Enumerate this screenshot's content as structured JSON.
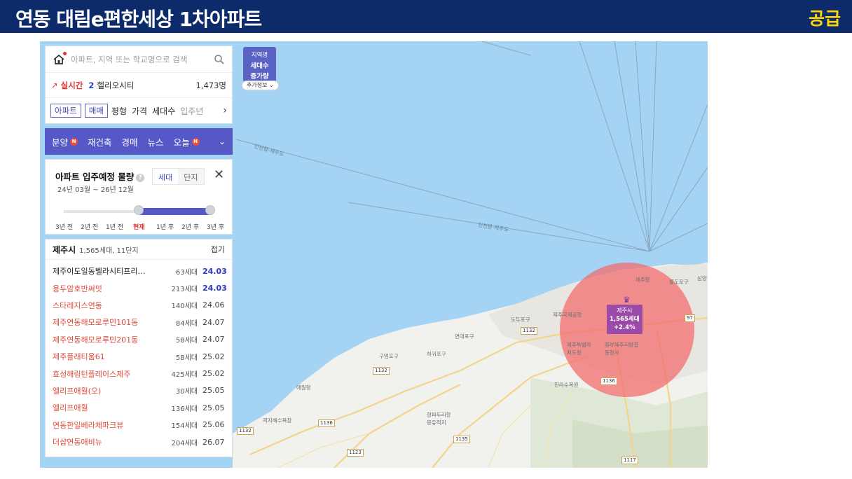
{
  "header": {
    "title": "연동 대림e편한세상 1차아파트",
    "badge": "공급"
  },
  "search": {
    "placeholder": "아파트, 지역 또는 학교명으로 검색"
  },
  "realtime": {
    "label": "실시간",
    "rank": "2",
    "name": "헬리오시티",
    "count": "1,473명"
  },
  "filters": {
    "chips": [
      "아파트",
      "매매"
    ],
    "items": [
      "평형",
      "가격",
      "세대수",
      "입주년"
    ]
  },
  "nav": {
    "items": [
      {
        "label": "분양",
        "new": "N"
      },
      {
        "label": "재건축",
        "new": ""
      },
      {
        "label": "경매",
        "new": ""
      },
      {
        "label": "뉴스",
        "new": ""
      },
      {
        "label": "오늘",
        "new": "N"
      }
    ]
  },
  "volume": {
    "title": "아파트 입주예정 물량",
    "help": "?",
    "range": "24년 03월 ~ 26년 12월",
    "toggle": [
      "세대",
      "단지"
    ],
    "active_toggle": "세대",
    "close": "✕",
    "ticks": [
      "3년 전",
      "2년 전",
      "1년 전",
      "현재",
      "1년 후",
      "2년 후",
      "3년 후"
    ],
    "current": "현재"
  },
  "list": {
    "city": "제주시",
    "summary": "1,565세대, 11단지",
    "fold": "접기",
    "rows": [
      {
        "name": "제주이도일동벨라시티프리…",
        "households": "63세대",
        "date": "24.03",
        "dark": true,
        "bold": true
      },
      {
        "name": "용두암호반써밋",
        "households": "213세대",
        "date": "24.03",
        "dark": false,
        "bold": true
      },
      {
        "name": "스타레지스연동",
        "households": "140세대",
        "date": "24.06",
        "dark": false,
        "bold": false
      },
      {
        "name": "제주연동해모로루민101동",
        "households": "84세대",
        "date": "24.07",
        "dark": false,
        "bold": false
      },
      {
        "name": "제주연동해모로루민201동",
        "households": "58세대",
        "date": "24.07",
        "dark": false,
        "bold": false
      },
      {
        "name": "제주플래티움61",
        "households": "58세대",
        "date": "25.02",
        "dark": false,
        "bold": false
      },
      {
        "name": "효성해링턴플레이스제주",
        "households": "425세대",
        "date": "25.02",
        "dark": false,
        "bold": false
      },
      {
        "name": "엘리프애월(오)",
        "households": "30세대",
        "date": "25.05",
        "dark": false,
        "bold": false
      },
      {
        "name": "엘리프애월",
        "households": "136세대",
        "date": "25.05",
        "dark": false,
        "bold": false
      },
      {
        "name": "연동한일베라체파크뷰",
        "households": "154세대",
        "date": "25.06",
        "dark": false,
        "bold": false
      },
      {
        "name": "더샵연동애비뉴",
        "households": "204세대",
        "date": "26.07",
        "dark": false,
        "bold": false
      }
    ]
  },
  "map_legend": {
    "line1": "지역명",
    "line2": "세대수",
    "line3": "증가량",
    "more": "추가정보"
  },
  "marker": {
    "city": "제주시",
    "households": "1,565세대",
    "change": "+2.4%"
  },
  "map_labels": [
    "제주항",
    "별도포구",
    "삼양",
    "제주국제공항",
    "도두포구",
    "연대포구",
    "구엄포구",
    "하귀포구",
    "제주특별자치도청",
    "정부제주지방합동청사",
    "한라수목원",
    "애월항",
    "곽지해수욕장",
    "항파두리항몽유적지",
    "인천항-제주도",
    "인천항-제주도"
  ],
  "roads": [
    "1132",
    "1132",
    "1136",
    "1135",
    "1123",
    "1132",
    "1136",
    "1117",
    "97"
  ],
  "colors": {
    "header": "#0d2a6b",
    "badge": "#ffd400",
    "nav": "#5758c7",
    "sea": "#a5d3f3",
    "land": "#f2f2ef",
    "circle": "#f36a6a",
    "marker": "#9b4aa8"
  }
}
